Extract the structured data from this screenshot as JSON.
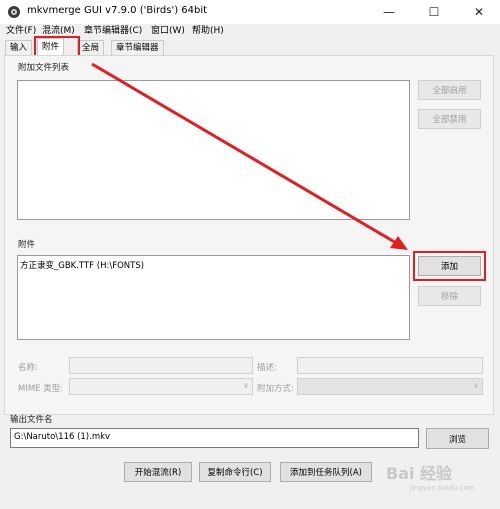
{
  "window": {
    "title": "mkvmerge GUI v7.9.0 ('Birds') 64bit",
    "controls": {
      "minimize": "—",
      "maximize": "☐",
      "close": "✕"
    }
  },
  "menu": [
    "文件(F)",
    "混流(M)",
    "章节编辑器(C)",
    "窗口(W)",
    "帮助(H)"
  ],
  "tabs": [
    "输入",
    "附件",
    "全局",
    "章节编辑器"
  ],
  "attached_files": {
    "label": "附加文件列表",
    "buttons": {
      "enable_all": "全部启用",
      "disable_all": "全部禁用"
    }
  },
  "attachments": {
    "label": "附件",
    "items": [
      "方正隶变_GBK.TTF (H:\\FONTS)"
    ],
    "buttons": {
      "add": "添加",
      "remove": "移除"
    }
  },
  "properties": {
    "name_label": "名称:",
    "description_label": "描述:",
    "mime_label": "MIME 类型:",
    "attach_mode_label": "附加方式:"
  },
  "output": {
    "label": "输出文件名",
    "value": "G:\\Naruto\\116 (1).mkv",
    "browse_label": "浏览"
  },
  "bottom_buttons": {
    "start_mux": "开始混流(R)",
    "copy_cmd": "复制命令行(C)",
    "add_to_queue": "添加到任务队列(A)"
  },
  "watermark": {
    "text": "Bai 经验",
    "sub": "jingyan.baidu.com"
  },
  "colors": {
    "highlight": "#e02020",
    "arrow": "#e02020"
  }
}
